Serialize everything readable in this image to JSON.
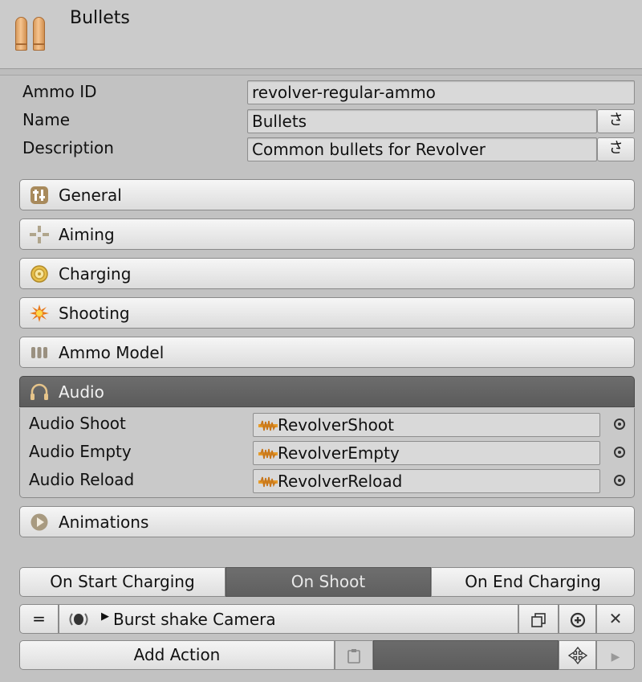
{
  "header": {
    "title": "Bullets",
    "icon": "bullets-icon"
  },
  "properties": [
    {
      "label": "Ammo ID",
      "value": "revolver-regular-ammo",
      "has_button": false
    },
    {
      "label": "Name",
      "value": "Bullets",
      "has_button": true,
      "button_label": "さ"
    },
    {
      "label": "Description",
      "value": "Common bullets for Revolver",
      "has_button": true,
      "button_label": "さ"
    }
  ],
  "sections": [
    {
      "label": "General",
      "icon": "general-icon",
      "expanded": false
    },
    {
      "label": "Aiming",
      "icon": "crosshair-icon",
      "expanded": false
    },
    {
      "label": "Charging",
      "icon": "charging-icon",
      "expanded": false
    },
    {
      "label": "Shooting",
      "icon": "explosion-icon",
      "expanded": false
    },
    {
      "label": "Ammo Model",
      "icon": "ammo-model-icon",
      "expanded": false
    },
    {
      "label": "Audio",
      "icon": "headphones-icon",
      "expanded": true
    },
    {
      "label": "Animations",
      "icon": "play-icon",
      "expanded": false
    }
  ],
  "audio": [
    {
      "label": "Audio Shoot",
      "value": "RevolverShoot"
    },
    {
      "label": "Audio Empty",
      "value": "RevolverEmpty"
    },
    {
      "label": "Audio Reload",
      "value": "RevolverReload"
    }
  ],
  "tabs": [
    {
      "label": "On Start Charging",
      "selected": false
    },
    {
      "label": "On Shoot",
      "selected": true
    },
    {
      "label": "On End Charging",
      "selected": false
    }
  ],
  "action": {
    "drag_label": "=",
    "name": "Burst shake Camera",
    "icon": "camera-shake-icon"
  },
  "add_action": {
    "label": "Add Action"
  },
  "colors": {
    "active_section": "#606060",
    "panel_bg": "#c2c2c2",
    "audio_icon": "#e69b2a"
  }
}
